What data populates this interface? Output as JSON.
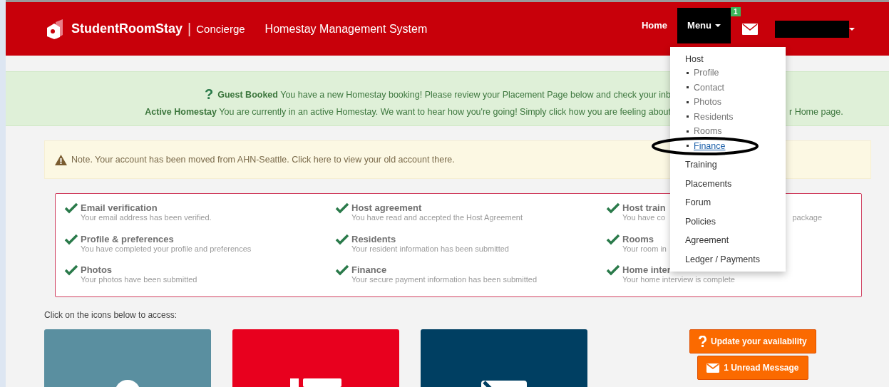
{
  "header": {
    "brand": "StudentRoomStay",
    "brand_sep": "|",
    "brand_sub": "Concierge",
    "title": "Homestay Management System",
    "nav": [
      {
        "label": "Home",
        "selected": false
      },
      {
        "label": "Menu",
        "selected": true
      }
    ],
    "mail_badge": "1"
  },
  "menu": {
    "section": "Host",
    "sub_items": [
      {
        "label": "Profile",
        "selected": false
      },
      {
        "label": "Contact",
        "selected": false
      },
      {
        "label": "Photos",
        "selected": false
      },
      {
        "label": "Residents",
        "selected": false
      },
      {
        "label": "Rooms",
        "selected": false
      },
      {
        "label": "Finance",
        "selected": true
      }
    ],
    "items": [
      "Training",
      "Placements",
      "Forum",
      "Policies",
      "Agreement",
      "Ledger / Payments"
    ]
  },
  "alert": {
    "icon": "?",
    "line_1": "**Guest Booked** You have a new Homestay booking! Please review your Placement Page below and check your inb",
    "line_2": "**Active Homestay** You are currently in an active Homestay. We want to hear how you're going! Simply click how you are feeling about",
    "line_2_tail": "r Home page."
  },
  "note": "Note. Your account has been moved from AHN-Seattle. Click here to view your old account there.",
  "checklist": [
    {
      "title": "Email verification",
      "desc": "Your email address has been verified.",
      "done": true
    },
    {
      "title": "Host agreement",
      "desc": "You have read and accepted the Host Agreement",
      "done": true
    },
    {
      "title": "Host train",
      "desc": "You have co",
      "desc_tail": "package",
      "done": true
    },
    {
      "title": "Profile & preferences",
      "desc": "You have completed your profile and preferences",
      "done": true
    },
    {
      "title": "Residents",
      "desc": "Your resident information has been submitted",
      "done": true
    },
    {
      "title": "Rooms",
      "desc": "Your room in",
      "done": true
    },
    {
      "title": "Photos",
      "desc": "Your photos have been submitted",
      "done": true
    },
    {
      "title": "Finance",
      "desc": "Your secure payment information has been submitted",
      "done": true
    },
    {
      "title": "Home inter",
      "desc": "Your home interview is complete",
      "done": true
    }
  ],
  "access_label": "Click on the icons below to access:",
  "tiles": [
    {
      "kind": "person",
      "color": "#5a8fa0"
    },
    {
      "kind": "list",
      "color": "#e8001e"
    },
    {
      "kind": "mail",
      "color": "#003f62"
    }
  ],
  "actions": [
    {
      "kind": "question",
      "label": "Update your availability"
    },
    {
      "kind": "mail",
      "label": "1 Unread Message"
    }
  ]
}
